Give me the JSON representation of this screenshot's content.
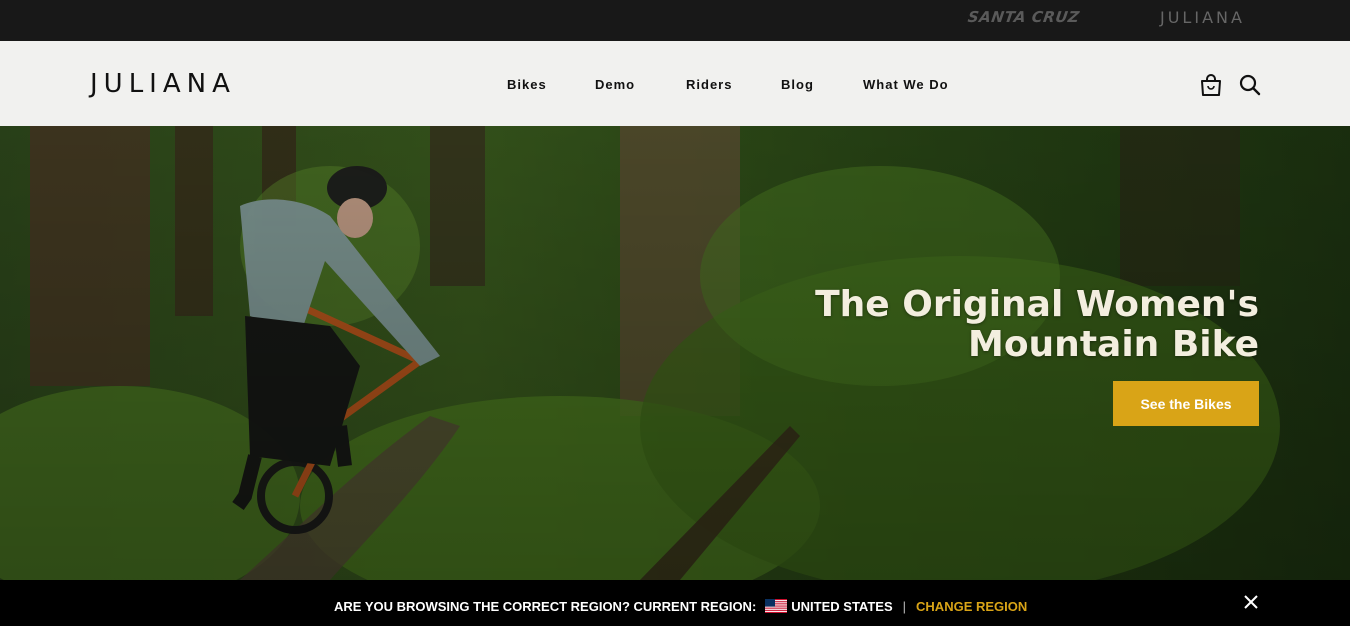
{
  "topbar": {
    "brands": [
      "SANTA CRUZ",
      "JULIANA"
    ]
  },
  "header": {
    "logo": "JULIANA",
    "nav": [
      "Bikes",
      "Demo",
      "Riders",
      "Blog",
      "What We Do"
    ],
    "icons": [
      "shopping-bag-icon",
      "search-icon"
    ]
  },
  "hero": {
    "title_line1": "The Original Women's",
    "title_line2": "Mountain Bike",
    "cta": "See the Bikes"
  },
  "region": {
    "prompt": "ARE YOU BROWSING THE CORRECT REGION? CURRENT REGION:",
    "current": "UNITED STATES",
    "separator": "|",
    "change": "CHANGE REGION",
    "flag_icon": "us-flag-icon",
    "close_icon": "close-icon"
  },
  "colors": {
    "accent": "#d9a417",
    "topbar": "#181818",
    "navbar": "#f1f1ef",
    "hero_text": "#f3eedf"
  }
}
